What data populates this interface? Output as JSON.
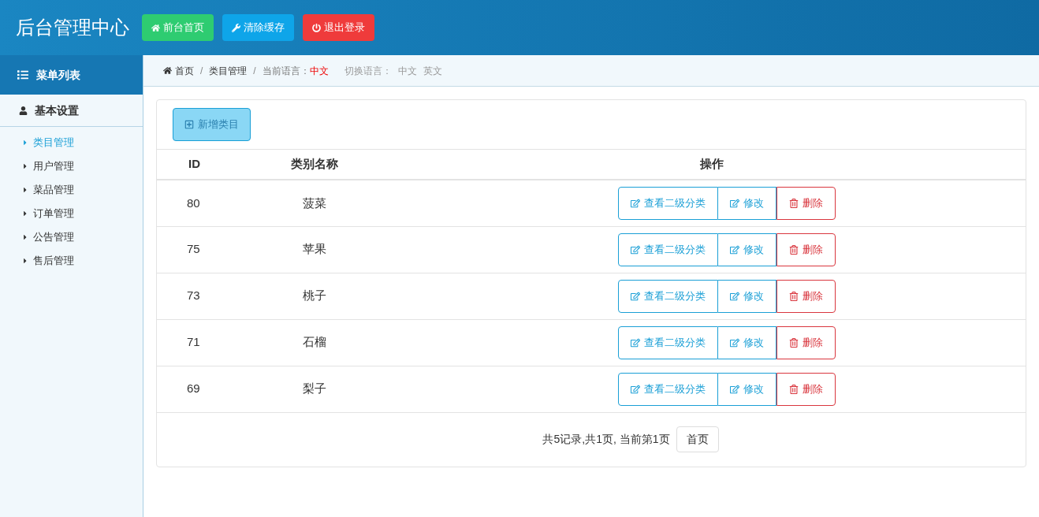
{
  "header": {
    "title": "后台管理中心",
    "buttons": [
      {
        "label": "前台首页",
        "kind": "home"
      },
      {
        "label": "清除缓存",
        "kind": "cache"
      },
      {
        "label": "退出登录",
        "kind": "logout"
      }
    ]
  },
  "sidebar": {
    "heading": "菜单列表",
    "group": "基本设置",
    "items": [
      {
        "label": "类目管理",
        "selected": true
      },
      {
        "label": "用户管理",
        "selected": false
      },
      {
        "label": "菜品管理",
        "selected": false
      },
      {
        "label": "订单管理",
        "selected": false
      },
      {
        "label": "公告管理",
        "selected": false
      },
      {
        "label": "售后管理",
        "selected": false
      }
    ]
  },
  "breadcrumb": {
    "items": [
      "首页",
      "类目管理"
    ],
    "separators": [
      "/",
      "/"
    ],
    "language_label": "当前语言：",
    "language": "中文",
    "switch_label": "切换语言：",
    "switch_options": [
      "中文",
      "英文"
    ]
  },
  "add_button": {
    "label": "新增类目",
    "disabled": true
  },
  "table": {
    "columns": [
      "ID",
      "类别名称",
      "操作"
    ],
    "rows": [
      {
        "id": "80",
        "name": "菠菜",
        "actions": [
          {
            "label": "查看二级分类",
            "kind": "view"
          },
          {
            "label": "修改",
            "kind": "edit"
          },
          {
            "label": "删除",
            "kind": "delete"
          }
        ]
      },
      {
        "id": "75",
        "name": "苹果",
        "actions": [
          {
            "label": "查看二级分类",
            "kind": "view"
          },
          {
            "label": "修改",
            "kind": "edit"
          },
          {
            "label": "删除",
            "kind": "delete"
          }
        ]
      },
      {
        "id": "73",
        "name": "桃子",
        "actions": [
          {
            "label": "查看二级分类",
            "kind": "view"
          },
          {
            "label": "修改",
            "kind": "edit"
          },
          {
            "label": "删除",
            "kind": "delete"
          }
        ]
      },
      {
        "id": "71",
        "name": "石榴",
        "actions": [
          {
            "label": "查看二级分类",
            "kind": "view"
          },
          {
            "label": "修改",
            "kind": "edit"
          },
          {
            "label": "删除",
            "kind": "delete"
          }
        ]
      },
      {
        "id": "69",
        "name": "梨子",
        "actions": [
          {
            "label": "查看二级分类",
            "kind": "view"
          },
          {
            "label": "修改",
            "kind": "edit"
          },
          {
            "label": "删除",
            "kind": "delete"
          }
        ]
      }
    ]
  },
  "pagination": {
    "summary": "共5记录,共1页, 当前第1页",
    "first": "首页"
  }
}
